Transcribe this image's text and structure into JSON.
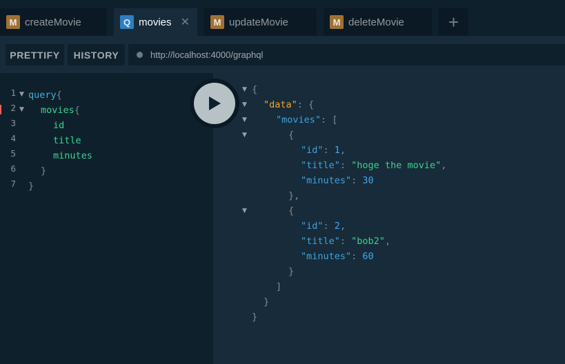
{
  "tabs": [
    {
      "badge": "M",
      "badge_color": "#a07136",
      "label": "createMovie",
      "active": false
    },
    {
      "badge": "Q",
      "badge_color": "#2e7fc2",
      "label": "movies",
      "active": true,
      "close": "✕"
    },
    {
      "badge": "M",
      "badge_color": "#a07136",
      "label": "updateMovie",
      "active": false
    },
    {
      "badge": "M",
      "badge_color": "#a07136",
      "label": "deleteMovie",
      "active": false
    }
  ],
  "add_tab_icon": "+",
  "toolbar": {
    "prettify_label": "PRETTIFY",
    "history_label": "HISTORY",
    "url": "http://localhost:4000/graphql"
  },
  "query_editor": {
    "line_numbers": [
      "1",
      "2",
      "3",
      "4",
      "5",
      "6",
      "7"
    ],
    "tokens": {
      "query_kw": "query",
      "open_brace": "{",
      "movies_field": "movies",
      "id_field": "id",
      "title_field": "title",
      "minutes_field": "minutes",
      "close_brace": "}"
    }
  },
  "result": {
    "data_key": "\"data\"",
    "movies_key": "\"movies\"",
    "items": [
      {
        "id_key": "\"id\"",
        "id_value": "1",
        "title_key": "\"title\"",
        "title_value": "\"hoge the movie\"",
        "minutes_key": "\"minutes\"",
        "minutes_value": "30"
      },
      {
        "id_key": "\"id\"",
        "id_value": "2",
        "title_key": "\"title\"",
        "title_value": "\"bob2\"",
        "minutes_key": "\"minutes\"",
        "minutes_value": "60"
      }
    ]
  },
  "icons": {
    "execute": "play-icon",
    "fold": "fold-arrow-icon",
    "status": "status-dot-icon"
  }
}
